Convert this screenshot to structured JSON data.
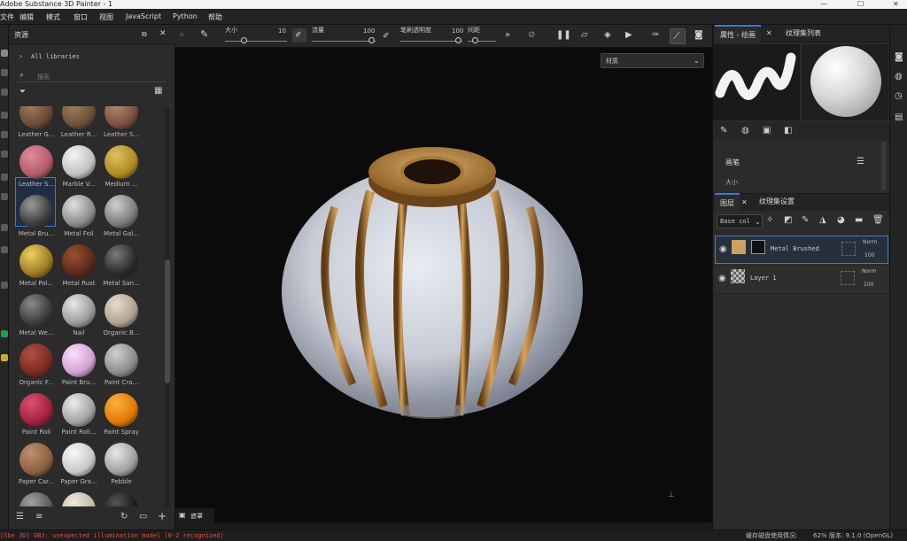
{
  "window": {
    "title": "Adobe Substance 3D Painter - 1",
    "controls": [
      "—",
      "☐",
      "✕"
    ]
  },
  "menu": [
    "文件",
    "编辑",
    "模式",
    "窗口",
    "视图",
    "JavaScript",
    "Python",
    "帮助"
  ],
  "assets_panel": {
    "title": "资源",
    "breadcrumb": "All libraries",
    "search_placeholder": "搜索",
    "materials": [
      {
        "label": "Leather G...",
        "color": "#6a4a38",
        "hi": "#a07a60"
      },
      {
        "label": "Leather R...",
        "color": "#6a5038",
        "hi": "#a08060"
      },
      {
        "label": "Leather S...",
        "color": "#7a5040",
        "hi": "#b08870"
      },
      {
        "label": "Leather S...",
        "color": "#b05a6a",
        "hi": "#e08a9a"
      },
      {
        "label": "Marble V...",
        "color": "#c0c0c0",
        "hi": "#f4f4f4"
      },
      {
        "label": "Medium ...",
        "color": "#b08a20",
        "hi": "#e0c060"
      },
      {
        "label": "Metal Bru...",
        "color": "#3a3a3a",
        "hi": "#9a9a9a",
        "selected": true
      },
      {
        "label": "Metal Foil",
        "color": "#8a8a8a",
        "hi": "#e0e0e0"
      },
      {
        "label": "Metal Gal...",
        "color": "#7a7a7a",
        "hi": "#d0d0d0"
      },
      {
        "label": "Metal Pol...",
        "color": "#9a7a20",
        "hi": "#f0d060"
      },
      {
        "label": "Metal Rust",
        "color": "#5a2a1a",
        "hi": "#9a5030"
      },
      {
        "label": "Metal San...",
        "color": "#2a2a2a",
        "hi": "#7a7a7a"
      },
      {
        "label": "Metal We...",
        "color": "#3a3a3a",
        "hi": "#8a8a8a"
      },
      {
        "label": "Nail",
        "color": "#9a9a9a",
        "hi": "#e8e8e8"
      },
      {
        "label": "Organic B...",
        "color": "#b0a090",
        "hi": "#e8dccc"
      },
      {
        "label": "Organic F...",
        "color": "#7a2a22",
        "hi": "#b05040"
      },
      {
        "label": "Paint Bru...",
        "color": "#d0a0d0",
        "hi": "#f8e0f8"
      },
      {
        "label": "Paint Cra...",
        "color": "#8a8a8a",
        "hi": "#d0d0d0"
      },
      {
        "label": "Paint Roll",
        "color": "#a02040",
        "hi": "#e05070"
      },
      {
        "label": "Paint Roll...",
        "color": "#a0a0a0",
        "hi": "#ececec"
      },
      {
        "label": "Paint Spray",
        "color": "#e07800",
        "hi": "#ffb040"
      },
      {
        "label": "Paper Car...",
        "color": "#8a6040",
        "hi": "#c09070"
      },
      {
        "label": "Paper Gra...",
        "color": "#c8c8c8",
        "hi": "#f8f8f8"
      },
      {
        "label": "Pebble",
        "color": "#a0a0a0",
        "hi": "#e8e8e8"
      },
      {
        "label": "",
        "color": "#5a5a5a",
        "hi": "#a0a0a0"
      },
      {
        "label": "",
        "color": "#c0b8a8",
        "hi": "#f0e8d8"
      },
      {
        "label": "",
        "color": "#1a1a1a",
        "hi": "#555555"
      }
    ]
  },
  "toolbar": {
    "size_label": "大小",
    "size_value": "10",
    "flow_label": "流量",
    "flow_value": "100",
    "opacity_label": "笔刷透明度",
    "opacity_value": "100",
    "spacing_label": "间距"
  },
  "viewport": {
    "material_dropdown": "材质",
    "bottom_tab": "遮罩"
  },
  "properties_panel": {
    "tab_properties": "属性 - 绘画",
    "tab_textureset_list": "纹理集列表",
    "brush_section": "画笔",
    "size_label": "大小"
  },
  "layers_panel": {
    "tab_layers": "图层",
    "tab_textureset_settings": "纹理集设置",
    "channel_select": "Base col",
    "layers": [
      {
        "name": "Metal Brushed",
        "blend": "Norm",
        "opacity": "100"
      },
      {
        "name": "Layer 1",
        "blend": "Norm",
        "opacity": "100"
      }
    ]
  },
  "statusbar": {
    "error": "[Sbe 3D] OBJ: unexpected illumination model (0-2 recognized)",
    "disk_label": "缓存磁盘使用情况:",
    "disk_value": "62%",
    "version": "版本: 9.1.0 (OpenGL)"
  }
}
